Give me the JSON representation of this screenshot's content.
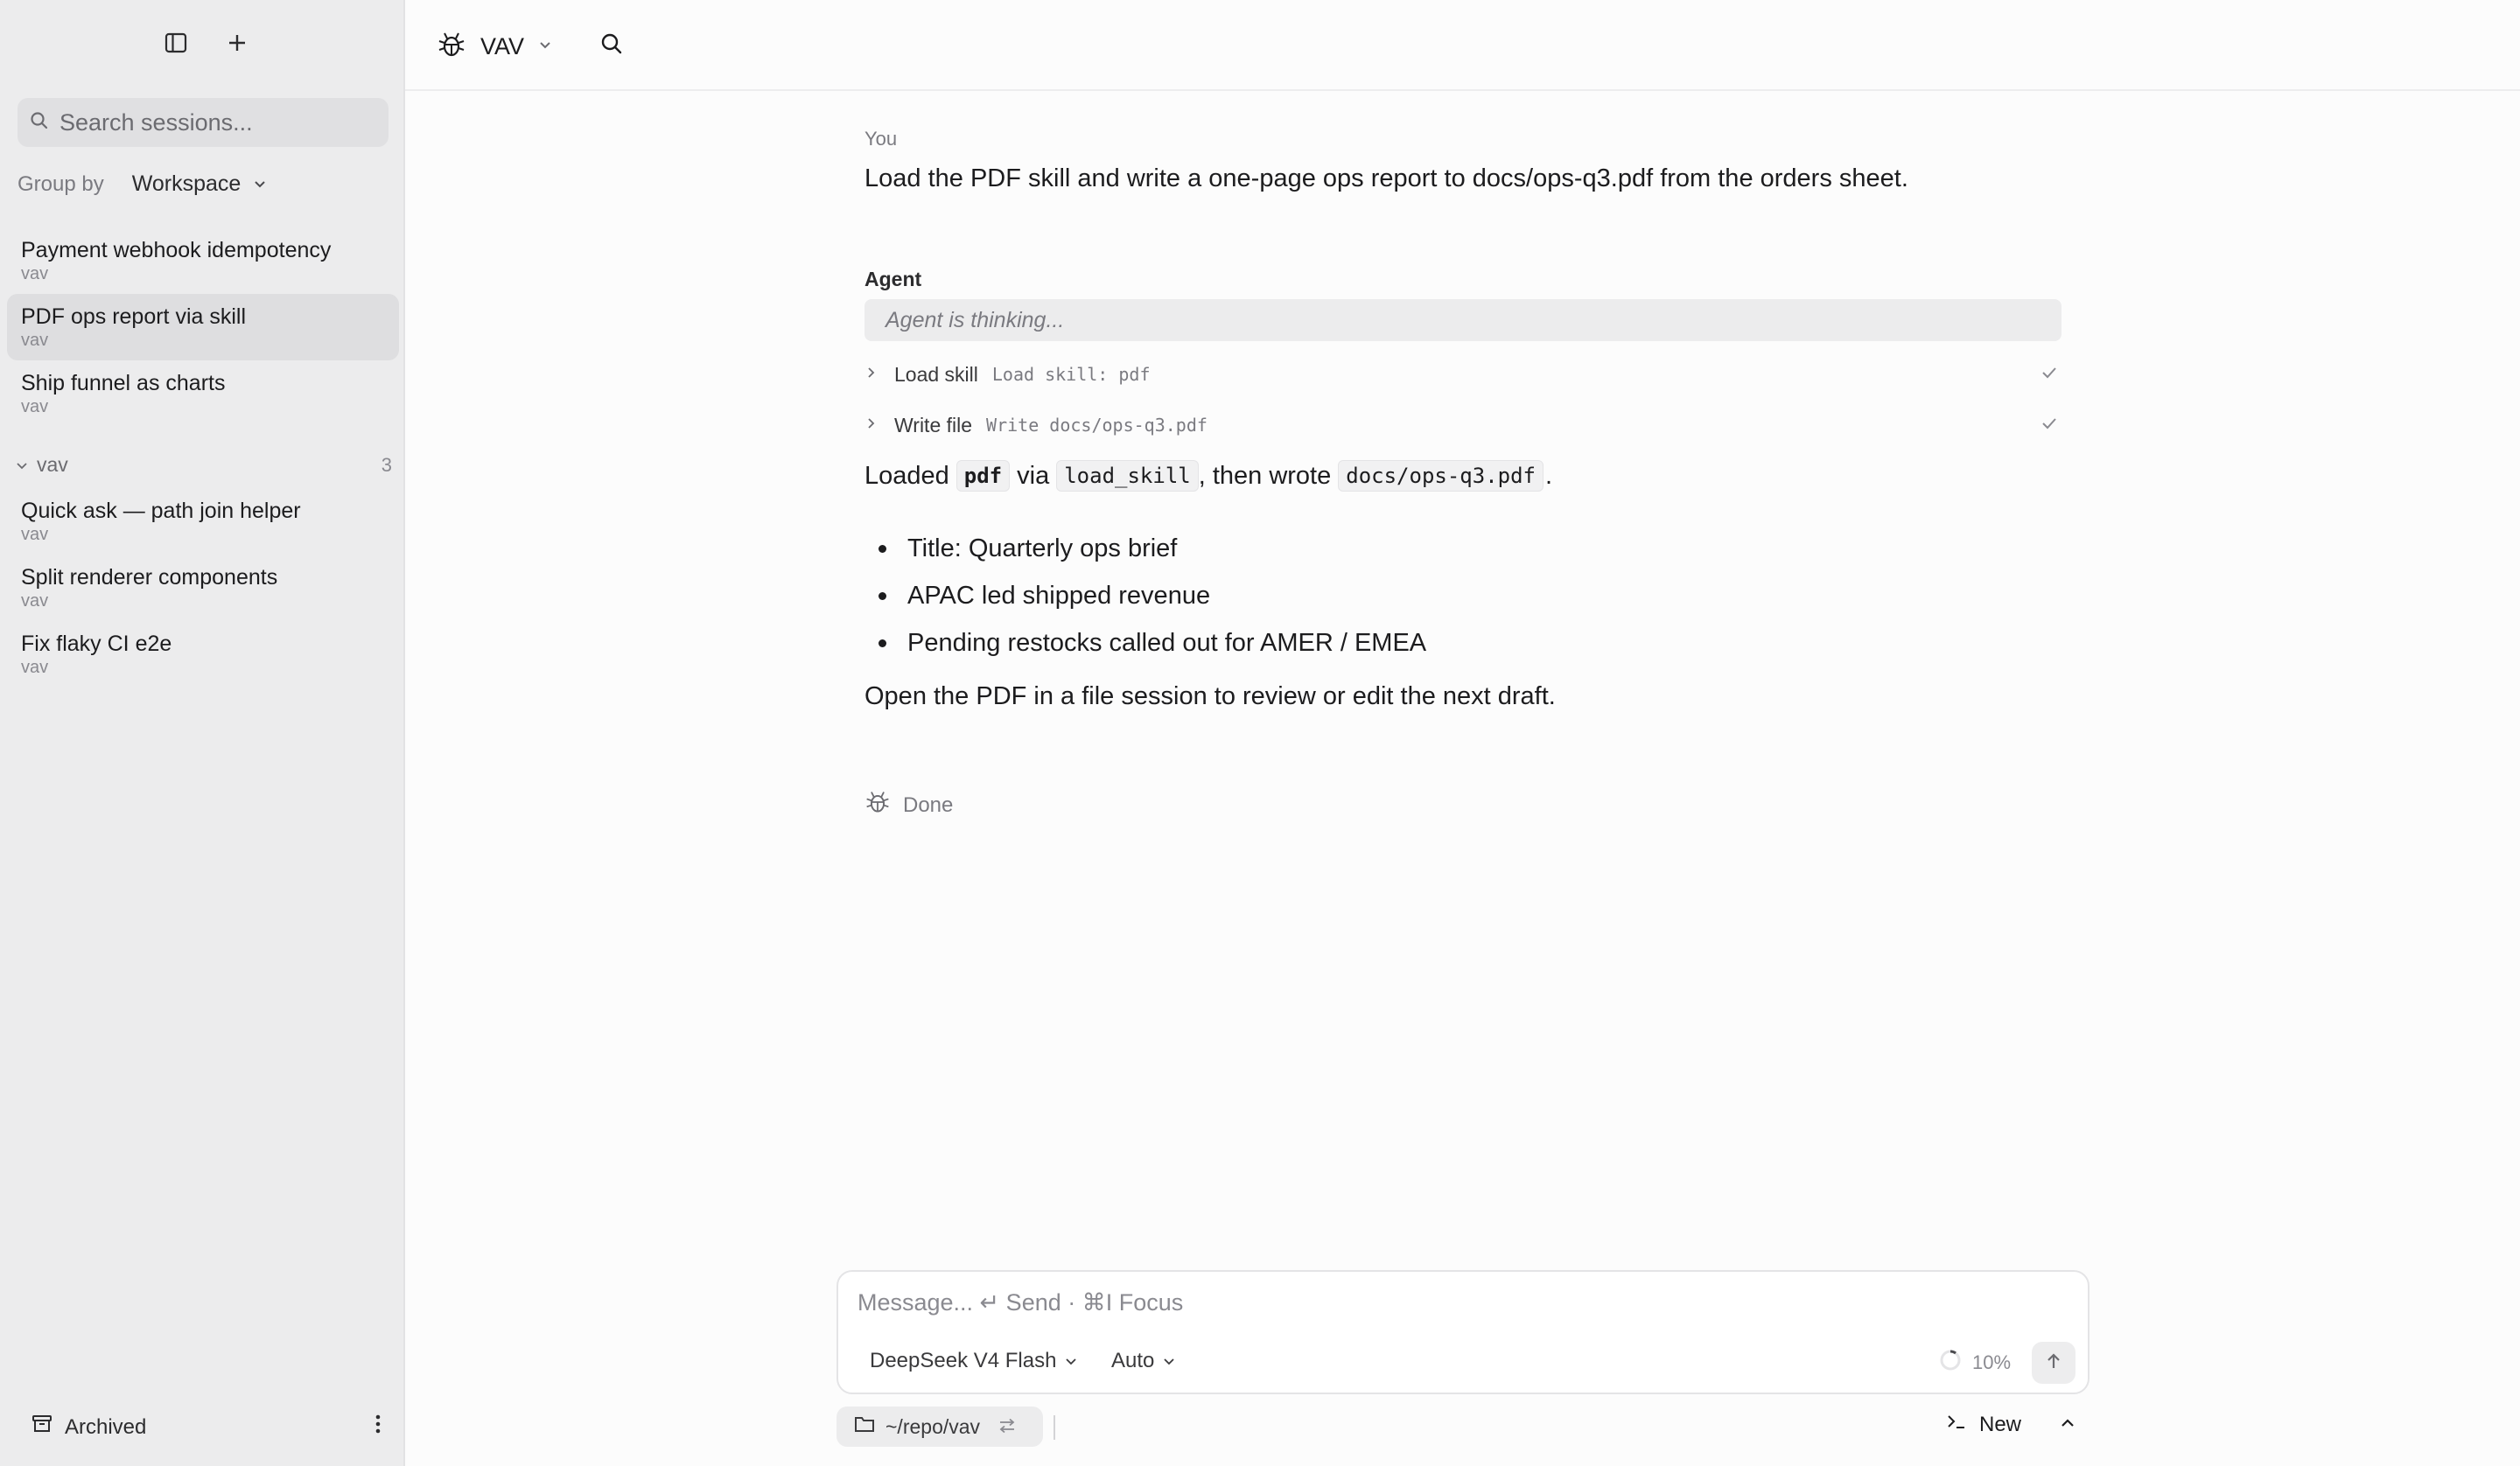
{
  "sidebar": {
    "search_placeholder": "Search sessions...",
    "group_by_label": "Group by",
    "group_by_value": "Workspace",
    "pinned_sessions": [
      {
        "title": "Payment webhook idempotency",
        "workspace": "vav"
      },
      {
        "title": "PDF ops report via skill",
        "workspace": "vav",
        "active": true
      },
      {
        "title": "Ship funnel as charts",
        "workspace": "vav"
      }
    ],
    "group": {
      "name": "vav",
      "count": "3",
      "sessions": [
        {
          "title": "Quick ask — path join helper",
          "workspace": "vav"
        },
        {
          "title": "Split renderer components",
          "workspace": "vav"
        },
        {
          "title": "Fix flaky CI e2e",
          "workspace": "vav"
        }
      ]
    },
    "archived_label": "Archived"
  },
  "topbar": {
    "workspace_name": "VAV"
  },
  "conversation": {
    "user_label": "You",
    "user_message": "Load the PDF skill and write a one-page ops report to docs/ops-q3.pdf from the orders sheet.",
    "agent_label": "Agent",
    "thinking_text": "Agent is thinking...",
    "tools": [
      {
        "name": "Load skill",
        "detail": "Load skill: pdf",
        "status": "done"
      },
      {
        "name": "Write file",
        "detail": "Write docs/ops-q3.pdf",
        "status": "done"
      }
    ],
    "summary": {
      "p1": "Loaded",
      "code1": "pdf",
      "p2": "via",
      "code2": "load_skill",
      "p3": ", then wrote",
      "code3": "docs/ops-q3.pdf",
      "p4": "."
    },
    "bullets": [
      "Title: Quarterly ops brief",
      "APAC led shipped revenue",
      "Pending restocks called out for AMER / EMEA"
    ],
    "closing": "Open the PDF in a file session to review or edit the next draft.",
    "status": "Done"
  },
  "composer": {
    "placeholder": "Message...  ↵ Send · ⌘I Focus",
    "model": "DeepSeek V4 Flash",
    "mode": "Auto",
    "context_usage": "10%"
  },
  "footer": {
    "path": "~/repo/vav",
    "new_label": "New"
  }
}
